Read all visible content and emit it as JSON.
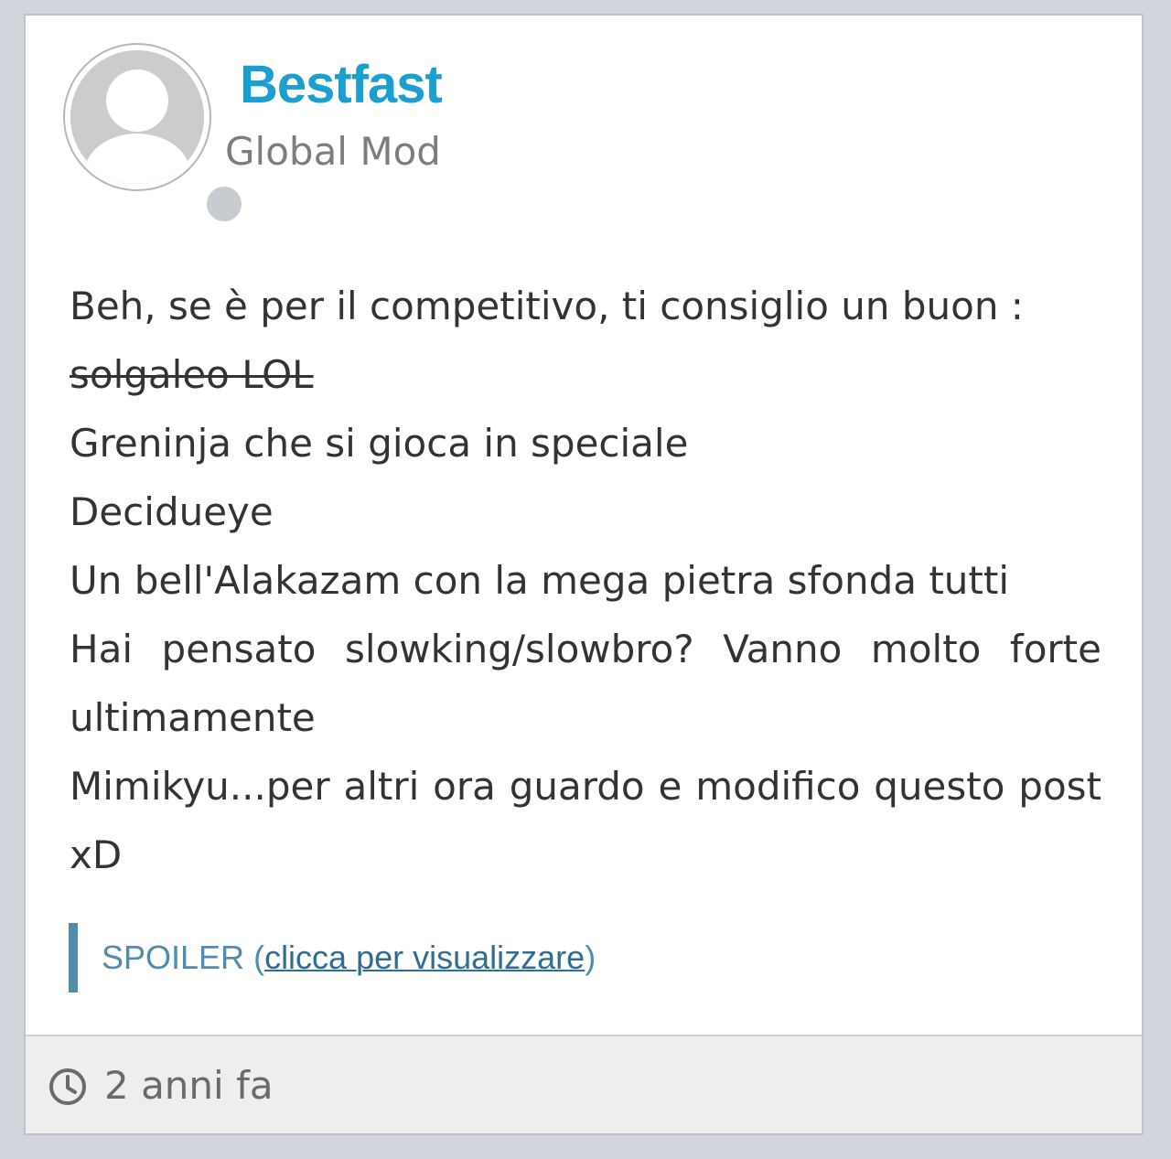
{
  "post": {
    "author": "Bestfast",
    "role": "Global Mod",
    "lines": [
      "Beh, se è per il competitivo, ti consiglio un buon :",
      "solgaleo LOL",
      "Greninja che si gioca in speciale",
      "Decidueye",
      "Un bell'Alakazam con la mega pietra sfonda tutti",
      "Hai pensato slowking/slowbro? Vanno molto forte ultimamente",
      "Mimikyu...per altri ora guardo e modifico questo post xD"
    ],
    "spoiler": {
      "label": "SPOILER",
      "open_paren": " (",
      "link_text": "clicca per visualizzare",
      "close_paren": ")"
    },
    "timestamp": "2 anni fa"
  },
  "icons": {
    "avatar": "default-user-avatar",
    "status": "status-dot",
    "time": "clock-icon"
  },
  "colors": {
    "username": "#1a9fd0",
    "role": "#7d7d7d",
    "spoiler_bar": "#4f8cb0",
    "spoiler_link": "#2f6e93",
    "background": "#d2d6dc"
  }
}
